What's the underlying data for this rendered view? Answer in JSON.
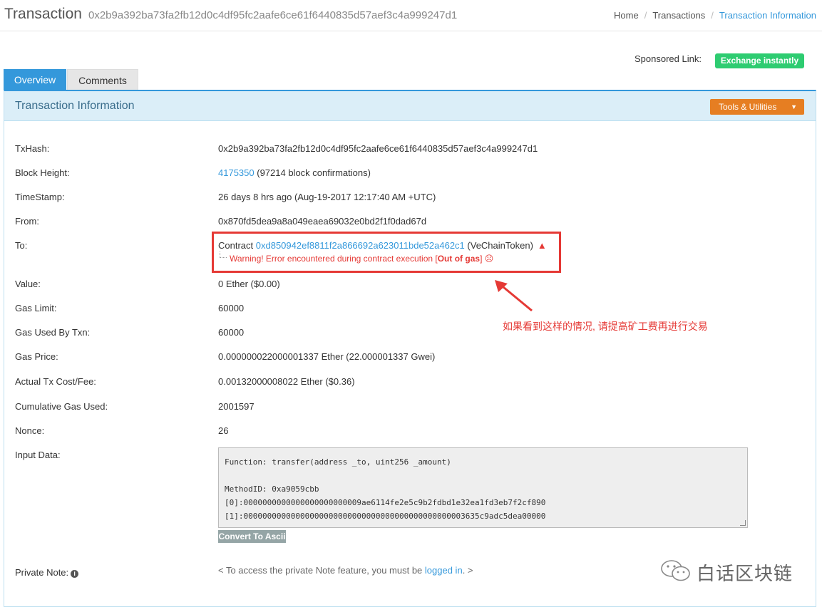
{
  "header": {
    "title": "Transaction",
    "hash": "0x2b9a392ba73fa2fb12d0c4df95fc2aafe6ce61f6440835d57aef3c4a999247d1",
    "breadcrumb": [
      "Home",
      "Transactions",
      "Transaction Information"
    ]
  },
  "sponsor": {
    "label": "Sponsored Link:",
    "button": "Exchange instantly",
    "color": "#2ecc71"
  },
  "tabs": [
    {
      "label": "Overview",
      "active": true
    },
    {
      "label": "Comments",
      "active": false
    }
  ],
  "panel": {
    "title": "Transaction Information",
    "tools_button": "Tools & Utilities"
  },
  "rows": {
    "txhash": {
      "label": "TxHash:",
      "value": "0x2b9a392ba73fa2fb12d0c4df95fc2aafe6ce61f6440835d57aef3c4a999247d1"
    },
    "block": {
      "label": "Block Height:",
      "link": "4175350",
      "suffix": " (97214 block confirmations)"
    },
    "timestamp": {
      "label": "TimeStamp:",
      "value": "26 days 8 hrs ago (Aug-19-2017 12:17:40 AM +UTC)"
    },
    "from": {
      "label": "From:",
      "link": "0x870fd5dea9a8a049eaea69032e0bd2f1f0dad67d"
    },
    "to": {
      "label": "To:",
      "prefix": "Contract ",
      "link": "0xd850942ef8811f2a866692a623011bde52a462c1",
      "suffix": " (VeChainToken)",
      "warning_prefix": "Warning! Error encountered during contract execution [",
      "warning_bold": "Out of gas",
      "warning_suffix": "] ☹"
    },
    "value": {
      "label": "Value:",
      "value": "0 Ether ($0.00)"
    },
    "gas_limit": {
      "label": "Gas Limit:",
      "value": "60000"
    },
    "gas_used": {
      "label": "Gas Used By Txn:",
      "value": "60000"
    },
    "gas_price": {
      "label": "Gas Price:",
      "value": "0.000000022000001337 Ether (22.000001337 Gwei)"
    },
    "fee": {
      "label": "Actual Tx Cost/Fee:",
      "value": "0.00132000008022 Ether ($0.36)"
    },
    "cumulative": {
      "label": "Cumulative Gas Used:",
      "value": "2001597"
    },
    "nonce": {
      "label": "Nonce:",
      "value": "26"
    },
    "input": {
      "label": "Input Data:",
      "value": "Function: transfer(address _to, uint256 _amount)\n\nMethodID: 0xa9059cbb\n[0]:0000000000000000000000009ae6114fe2e5c9b2fdbd1e32ea1fd3eb7f2cf890\n[1]:00000000000000000000000000000000000000000000003635c9adc5dea00000",
      "button": "Convert To Ascii"
    },
    "note": {
      "label": "Private Note:",
      "prefix": "< To access the private Note feature, you must be ",
      "link": "logged in",
      "suffix": ". >"
    }
  },
  "annotation": "如果看到这样的情况, 请提高矿工费再进行交易",
  "watermark": "白话区块链"
}
